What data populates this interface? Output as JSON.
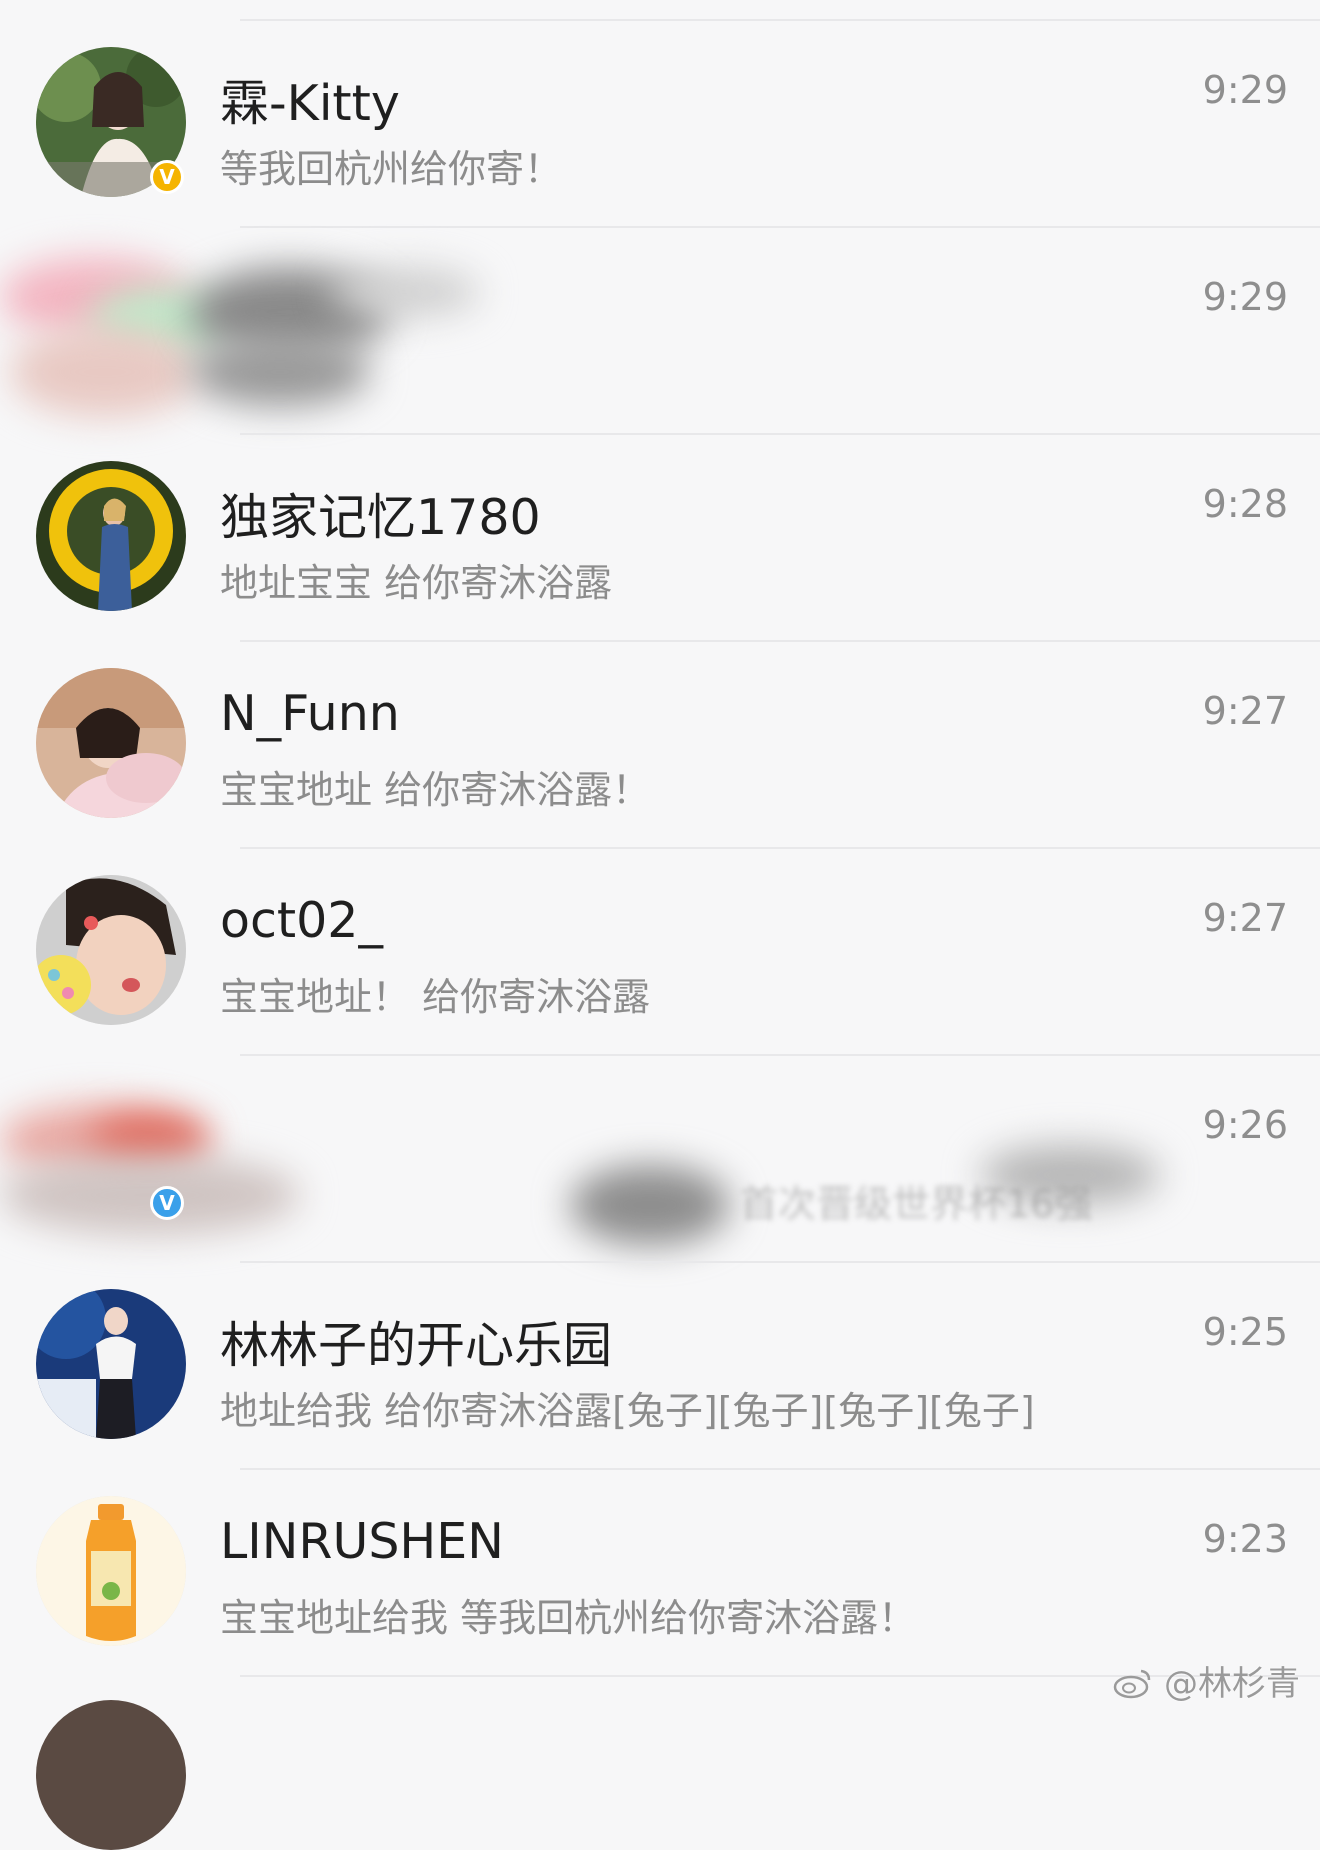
{
  "conversations": [
    {
      "name": "霖-Kitty",
      "message": "等我回杭州给你寄！",
      "time": "9:29",
      "verified": "gold",
      "avatar": "avatar-photo"
    },
    {
      "name": "",
      "message": "",
      "time": "9:29",
      "obscured": true
    },
    {
      "name": "独家记忆1780",
      "message": "地址宝宝 给你寄沐浴露",
      "time": "9:28",
      "avatar": "avatar-photo"
    },
    {
      "name": "N_Funn",
      "message": "宝宝地址 给你寄沐浴露！",
      "time": "9:27",
      "avatar": "avatar-photo"
    },
    {
      "name": "oct02_",
      "message": "宝宝地址！ 给你寄沐浴露",
      "time": "9:27",
      "avatar": "avatar-photo"
    },
    {
      "name": "",
      "message": "首次晋级世界杯16强",
      "time": "9:26",
      "obscured": true,
      "verified": "blue"
    },
    {
      "name": "林林子的开心乐园",
      "message": "地址给我 给你寄沐浴露[兔子][兔子][兔子][兔子]",
      "time": "9:25",
      "avatar": "avatar-photo"
    },
    {
      "name": "LINRUSHEN",
      "message": "宝宝地址给我 等我回杭州给你寄沐浴露！",
      "time": "9:23",
      "avatar": "avatar-photo"
    }
  ],
  "watermark": "@林杉青",
  "watermark_icon": "weibo-icon"
}
